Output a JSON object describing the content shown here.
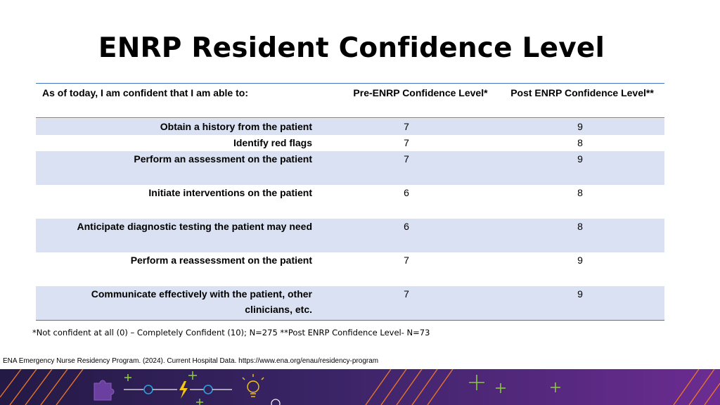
{
  "title": "ENRP Resident Confidence Level",
  "table": {
    "headers": {
      "statement": "As of today, I am confident that I am able to:",
      "pre": "Pre-ENRP Confidence Level*",
      "post": "Post ENRP Confidence Level**"
    },
    "rows": [
      {
        "statement": "Obtain a history from the patient",
        "pre": "7",
        "post": "9"
      },
      {
        "statement": "Identify red flags",
        "pre": "7",
        "post": "8"
      },
      {
        "statement": "Perform an assessment on the patient",
        "pre": "7",
        "post": "9"
      },
      {
        "statement": "Initiate interventions on the patient",
        "pre": "6",
        "post": "8"
      },
      {
        "statement": "Anticipate diagnostic testing the patient may need",
        "pre": "6",
        "post": "8"
      },
      {
        "statement": "Perform a reassessment on the patient",
        "pre": "7",
        "post": "9"
      },
      {
        "statement": "Communicate effectively with the patient, other clinicians, etc.",
        "pre": "7",
        "post": "9"
      }
    ]
  },
  "footnote": "*Not confident at all (0) – Completely Confident (10); N=275 **Post ENRP Confidence Level- N=73",
  "source": "ENA Emergency Nurse Residency Program. (2024). Current Hospital Data. https://www.ena.org/enau/residency-program",
  "colors": {
    "banner_dark": "#2a1f4e",
    "banner_purple": "#6b2c91",
    "accent_orange": "#e8732a",
    "accent_green": "#8cc63f",
    "accent_yellow": "#f5c518",
    "accent_blue": "#2f9fd8",
    "rule_blue": "#4472c4",
    "row_shade": "#d9e1f2"
  },
  "icons": [
    "puzzle-icon",
    "lightning-icon",
    "lightbulb-icon",
    "plus-icon"
  ]
}
